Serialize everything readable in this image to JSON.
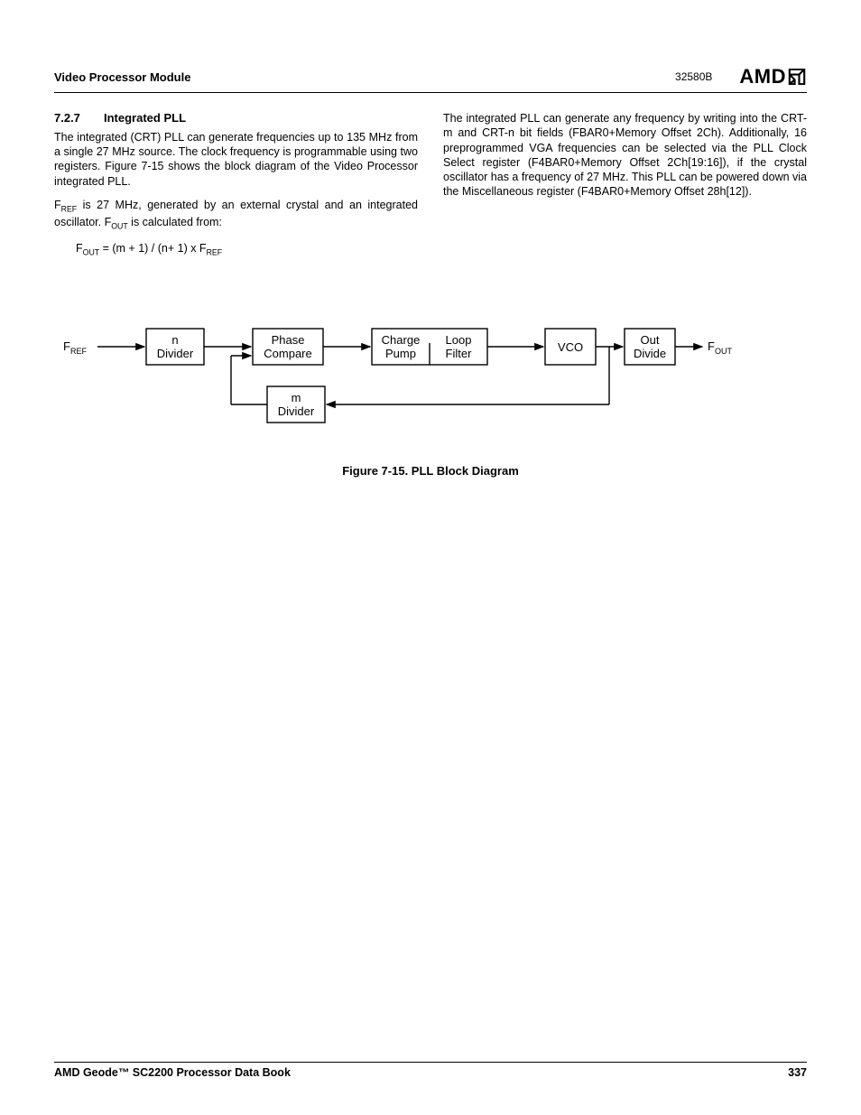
{
  "header": {
    "left": "Video Processor Module",
    "docnum": "32580B",
    "logo": "AMD"
  },
  "section": {
    "number": "7.2.7",
    "title": "Integrated PLL"
  },
  "left_col": {
    "p1": "The integrated (CRT) PLL can generate frequencies up to 135 MHz from a single 27 MHz source. The clock frequency is programmable using two registers. Figure 7-15 shows the block diagram of the Video Processor integrated PLL.",
    "p2_a": "F",
    "p2_b": " is 27 MHz, generated by an external crystal and an integrated oscillator. F",
    "p2_c": " is calculated from:",
    "formula_a": "F",
    "formula_b": " = (m + 1) / (n+ 1) x F"
  },
  "right_col": {
    "p1": "The integrated PLL can generate any frequency by writing into the CRT-m and CRT-n bit fields (FBAR0+Memory Offset 2Ch). Additionally, 16 preprogrammed VGA frequencies can be selected via the PLL Clock Select register (F4BAR0+Memory Offset 2Ch[19:16]), if the crystal oscillator has a frequency of 27 MHz. This PLL can be powered down via the Miscellaneous register (F4BAR0+Memory Offset 28h[12])."
  },
  "diagram": {
    "fref": "F",
    "fref_sub": "REF",
    "fout": "F",
    "fout_sub": "OUT",
    "blocks": {
      "n_div_l1": "n",
      "n_div_l2": "Divider",
      "phase_l1": "Phase",
      "phase_l2": "Compare",
      "charge_l1": "Charge",
      "charge_l2": "Pump",
      "loop_l1": "Loop",
      "loop_l2": "Filter",
      "vco": "VCO",
      "out_l1": "Out",
      "out_l2": "Divide",
      "m_div_l1": "m",
      "m_div_l2": "Divider"
    }
  },
  "figure_caption": "Figure 7-15.  PLL Block Diagram",
  "footer": {
    "left": "AMD Geode™ SC2200  Processor Data Book",
    "right": "337"
  }
}
